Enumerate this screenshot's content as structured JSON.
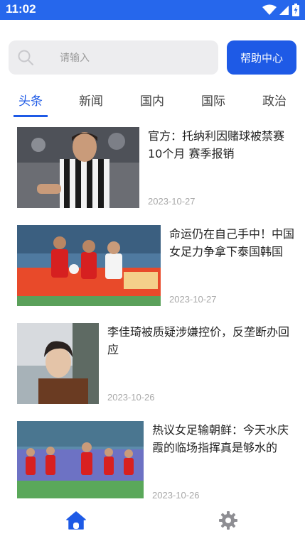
{
  "status_bar": {
    "time": "11:02",
    "icons": [
      "wifi-icon",
      "signal-icon",
      "battery-charging-icon"
    ]
  },
  "search": {
    "placeholder": "请输入",
    "icon": "search-icon"
  },
  "help_button": {
    "label": "帮助中心"
  },
  "tabs": [
    {
      "label": "头条",
      "active": true
    },
    {
      "label": "新闻",
      "active": false
    },
    {
      "label": "国内",
      "active": false
    },
    {
      "label": "国际",
      "active": false
    },
    {
      "label": "政治",
      "active": false
    }
  ],
  "news": [
    {
      "title": "官方：托纳利因赌球被禁赛10个月 赛季报销",
      "date": "2023-10-27"
    },
    {
      "title": "命运仍在自己手中！中国女足力争拿下泰国韩国",
      "date": "2023-10-27"
    },
    {
      "title": "李佳琦被质疑涉嫌控价，反垄断办回应",
      "date": "2023-10-26"
    },
    {
      "title": "热议女足输朝鲜：今天水庆霞的临场指挥真是够水的",
      "date": "2023-10-26"
    }
  ],
  "bottom_nav": {
    "items": [
      "home-icon",
      "settings-icon"
    ],
    "active": "home-icon"
  },
  "colors": {
    "accent": "#1e5ae6",
    "status_bar": "#2667ec"
  }
}
